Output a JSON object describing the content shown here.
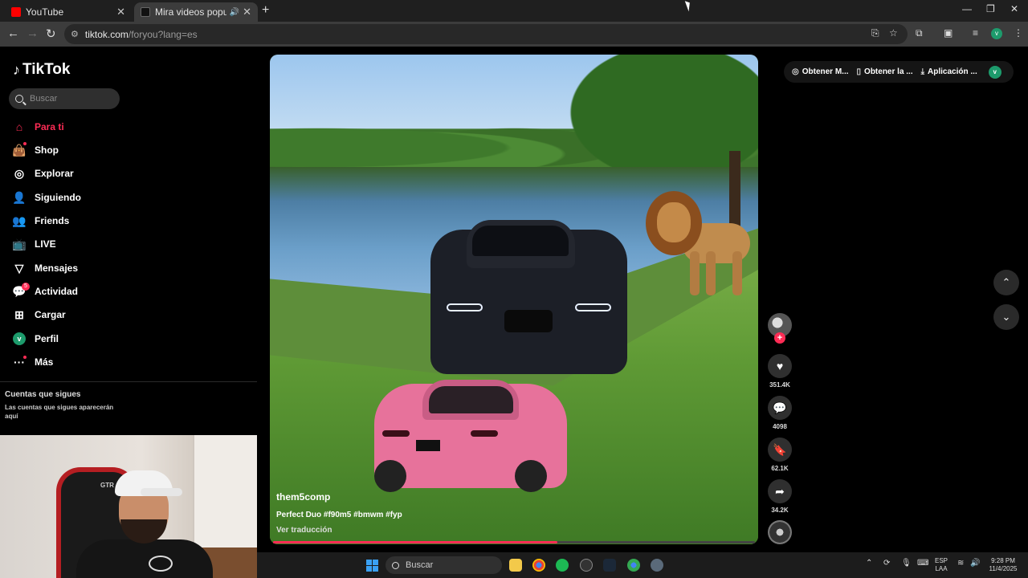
{
  "browser": {
    "tabs": [
      {
        "title": "YouTube",
        "favicon_color": "#ff0000"
      },
      {
        "title": "Mira videos populares selec",
        "favicon_color": "#111111"
      }
    ],
    "url_host": "tiktok.com",
    "url_path": "/foryou?lang=es",
    "profile_initial": "v"
  },
  "sidebar": {
    "logo": "TikTok",
    "search_placeholder": "Buscar",
    "items": [
      {
        "label": "Para ti",
        "icon": "home-icon",
        "active": true
      },
      {
        "label": "Shop",
        "icon": "shop-bag-icon"
      },
      {
        "label": "Explorar",
        "icon": "compass-icon"
      },
      {
        "label": "Siguiendo",
        "icon": "following-icon"
      },
      {
        "label": "Friends",
        "icon": "friends-icon"
      },
      {
        "label": "LIVE",
        "icon": "live-tv-icon"
      },
      {
        "label": "Mensajes",
        "icon": "messages-icon"
      },
      {
        "label": "Actividad",
        "icon": "activity-icon",
        "badge": "5"
      },
      {
        "label": "Cargar",
        "icon": "upload-plus-icon"
      },
      {
        "label": "Perfil",
        "icon": "profile-avatar",
        "initial": "v"
      },
      {
        "label": "Más",
        "icon": "more-dots-icon"
      }
    ],
    "following_title": "Cuentas que sigues",
    "following_subtitle": "Las cuentas que sigues aparecerán aquí"
  },
  "topbar": {
    "items": [
      "Obtener M...",
      "Obtener la ...",
      "Aplicación ..."
    ],
    "profile_initial": "v"
  },
  "video": {
    "username": "them5comp",
    "caption": "Perfect Duo #f90m5 #bmwm #fyp",
    "translate": "Ver traducción",
    "progress_fraction": 0.59,
    "chair_brand": "GTR"
  },
  "actions": {
    "likes": "351.4K",
    "comments": "4098",
    "saves": "62.1K",
    "shares": "34.2K"
  },
  "taskbar": {
    "search_placeholder": "Buscar",
    "lang_line1": "ESP",
    "lang_line2": "LAA",
    "time": "9:28 PM",
    "date": "11/4/2025"
  },
  "colors": {
    "accent": "#fe2c55",
    "avatar": "#1d9b6c"
  }
}
